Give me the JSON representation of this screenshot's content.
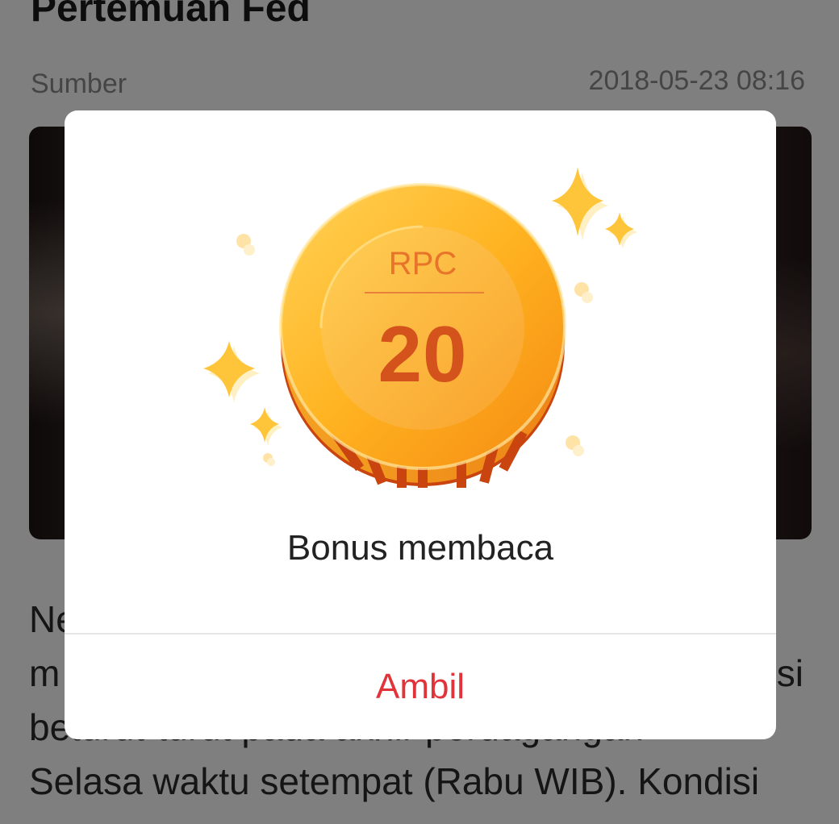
{
  "article": {
    "title": "Pertemuan Fed",
    "source": "Sumber",
    "date": "2018-05-23 08:16",
    "body_lines": [
      "Ne",
      "m",
      "si",
      "beturut-turut pada akhir perdagangan",
      "Selasa waktu setempat (Rabu WIB). Kondisi"
    ]
  },
  "modal": {
    "coin": {
      "unit": "RPC",
      "amount": "20"
    },
    "label": "Bonus membaca",
    "button_label": "Ambil"
  },
  "colors": {
    "accent": "#e0343a",
    "coin_gold": "#ffb321",
    "coin_orange": "#f6911e",
    "coin_text": "#d4521c",
    "sparkle": "#ffc53a",
    "overlay": "rgba(0,0,0,0.5)"
  }
}
